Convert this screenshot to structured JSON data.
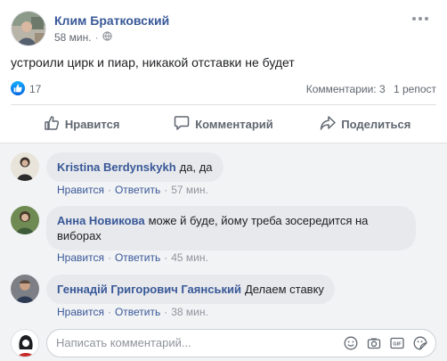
{
  "post": {
    "author": "Клим Братковский",
    "time": "58 мин.",
    "privacy_icon": "globe-icon",
    "text": "устроили цирк и пиар, никакой отставки не будет",
    "likes": "17",
    "comments_count": "Комментарии: 3",
    "reposts": "1 репост"
  },
  "actions": {
    "like": "Нравится",
    "comment": "Комментарий",
    "share": "Поделиться"
  },
  "comments": [
    {
      "author": "Kristina Berdynskykh",
      "text": "да, да",
      "like": "Нравится",
      "reply": "Ответить",
      "time": "57 мин."
    },
    {
      "author": "Анна Новикова",
      "text": "може й буде, йому треба зосередится на виборах",
      "like": "Нравится",
      "reply": "Ответить",
      "time": "45 мин."
    },
    {
      "author": "Геннадій Григорович Гаянський",
      "text": "Делаем ставку",
      "like": "Нравится",
      "reply": "Ответить",
      "time": "38 мин."
    }
  ],
  "composer": {
    "placeholder": "Написать комментарий..."
  },
  "colors": {
    "link": "#385898",
    "meta": "#616770",
    "like_blue": "#1877f2"
  }
}
